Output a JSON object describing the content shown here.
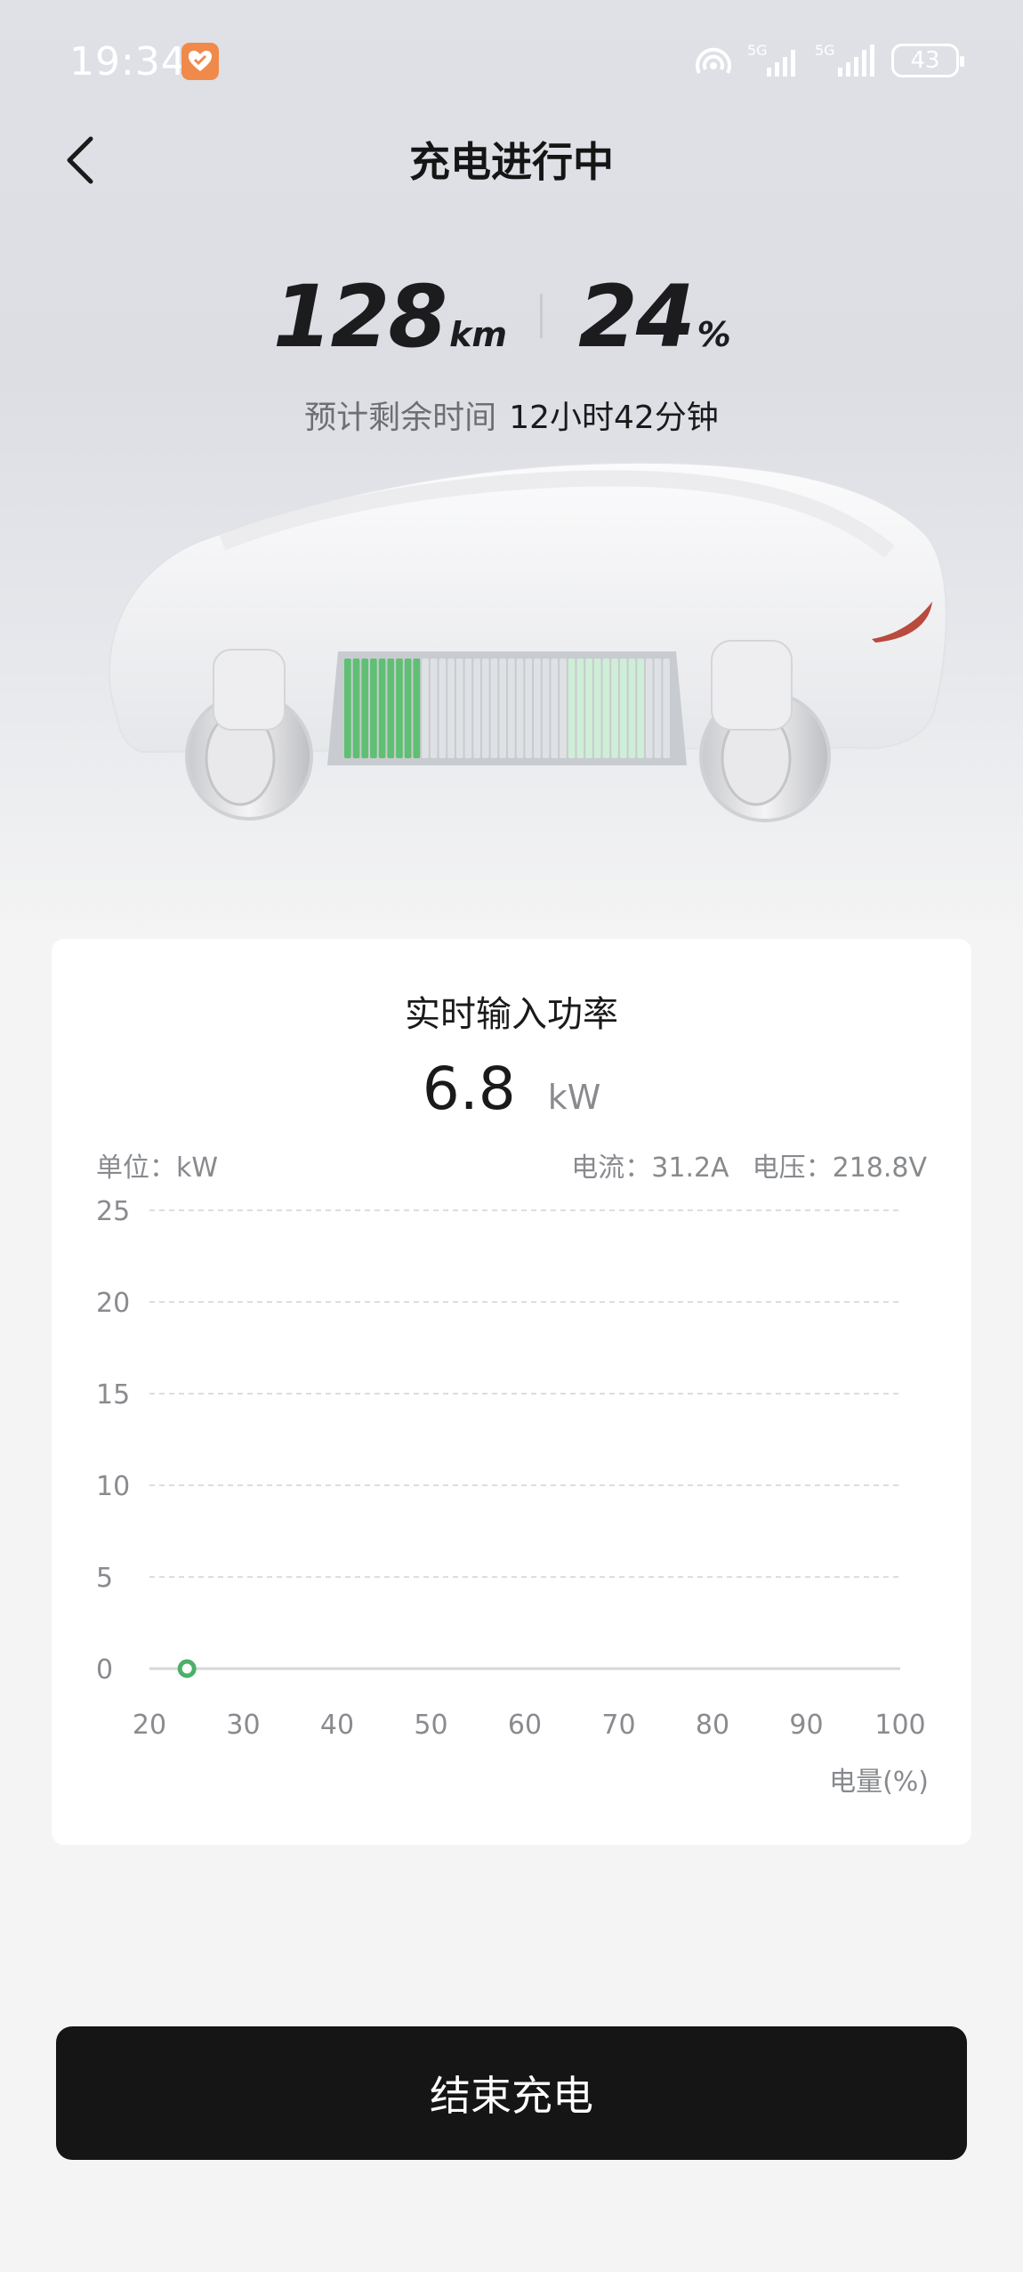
{
  "status_bar": {
    "time": "19:34",
    "network_1": "5G",
    "network_2": "5G",
    "battery_level": "43"
  },
  "header": {
    "title": "充电进行中"
  },
  "stats": {
    "range_value": "128",
    "range_unit": "km",
    "battery_value": "24",
    "battery_unit": "%"
  },
  "eta": {
    "label": "预计剩余时间",
    "value": "12小时42分钟"
  },
  "battery_pack": {
    "charge_fraction": 0.24,
    "fill_color": "#5fbf73"
  },
  "power_card": {
    "title": "实时输入功率",
    "value": "6.8",
    "unit": "kW",
    "unit_label": "单位：kW",
    "current": "电流：31.2A",
    "voltage": "电压：218.8V",
    "x_title": "电量(%)"
  },
  "chart_data": {
    "type": "line",
    "xlabel": "电量(%)",
    "ylabel": "单位：kW",
    "xlim": [
      20,
      100
    ],
    "ylim": [
      0,
      25
    ],
    "x_ticks": [
      20,
      30,
      40,
      50,
      60,
      70,
      80,
      90,
      100
    ],
    "y_ticks": [
      0,
      5,
      10,
      15,
      20,
      25
    ],
    "grid": true,
    "series": [
      {
        "x": [
          24
        ],
        "y": [
          0
        ],
        "color": "#4caf6a"
      }
    ]
  },
  "actions": {
    "end_charge_label": "结束充电"
  }
}
